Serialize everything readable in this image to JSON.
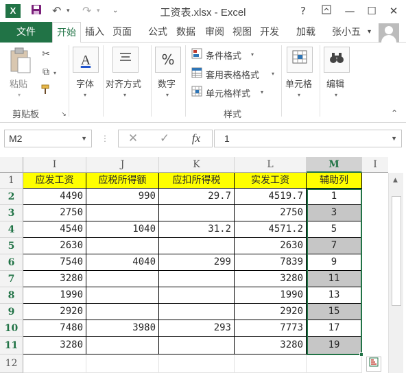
{
  "titlebar": {
    "app_icon": "excel-logo-icon",
    "app_logo_letter": "X",
    "title": "工资表.xlsx - Excel",
    "help": "?",
    "restore_icon": "ribbon-display-icon",
    "minimize": "—",
    "maximize": "☐",
    "close": "✕"
  },
  "tabs": [
    "文件",
    "开始",
    "插入",
    "页面",
    "公式",
    "数据",
    "审阅",
    "视图",
    "开发",
    "加载"
  ],
  "user": {
    "name": "张小五",
    "menu": "▾"
  },
  "ribbon": {
    "paste_label": "粘贴",
    "clipboard_group": "剪贴板",
    "font_label": "字体",
    "align_label": "对齐方式",
    "number_label": "数字",
    "cond_format": "条件格式",
    "table_format": "套用表格格式",
    "cell_style": "单元格样式",
    "styles_group": "样式",
    "cells_label": "单元格",
    "edit_label": "编辑",
    "number_glyph": "%",
    "font_glyph": "A"
  },
  "formula_bar": {
    "name_box": "M2",
    "cancel": "✕",
    "enter": "✓",
    "fx": "fx",
    "value": "1"
  },
  "sheet": {
    "columns": [
      "I",
      "J",
      "K",
      "L",
      "M"
    ],
    "next_col_partial": "I",
    "row_numbers": [
      "1",
      "2",
      "3",
      "4",
      "5",
      "6",
      "7",
      "8",
      "9",
      "10",
      "11",
      "12"
    ],
    "headers": [
      "应发工资",
      "应税所得额",
      "应扣所得税",
      "实发工资",
      "辅助列"
    ],
    "rows": [
      [
        "4490",
        "990",
        "29.7",
        "4519.7",
        "1"
      ],
      [
        "2750",
        "",
        "",
        "2750",
        "3"
      ],
      [
        "4540",
        "1040",
        "31.2",
        "4571.2",
        "5"
      ],
      [
        "2630",
        "",
        "",
        "2630",
        "7"
      ],
      [
        "7540",
        "4040",
        "299",
        "7839",
        "9"
      ],
      [
        "3280",
        "",
        "",
        "3280",
        "11"
      ],
      [
        "1990",
        "",
        "",
        "1990",
        "13"
      ],
      [
        "2920",
        "",
        "",
        "2920",
        "15"
      ],
      [
        "7480",
        "3980",
        "293",
        "7773",
        "17"
      ],
      [
        "3280",
        "",
        "",
        "3280",
        "19"
      ]
    ]
  },
  "colors": {
    "accent": "#217346",
    "header_fill": "#ffff00",
    "selection_fill": "#c6c6c6"
  }
}
